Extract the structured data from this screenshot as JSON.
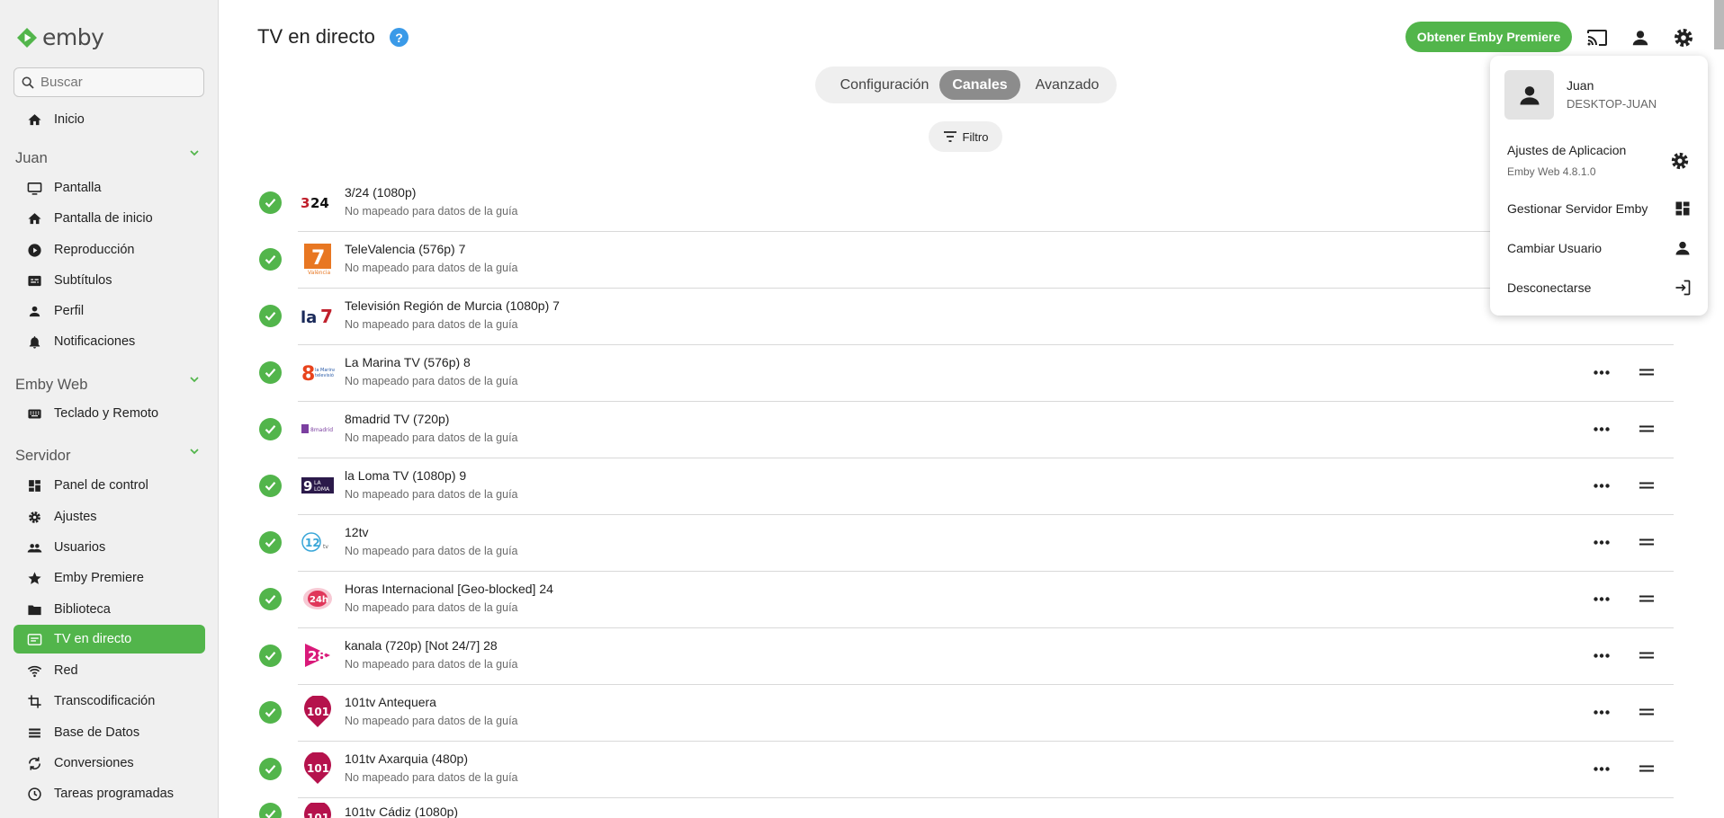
{
  "app": {
    "brand": "emby"
  },
  "colors": {
    "accent": "#52b54b",
    "help": "#3a9ae8"
  },
  "sidebar": {
    "search_placeholder": "Buscar",
    "home": "Inicio",
    "sections": [
      {
        "title": "Juan",
        "items": [
          "Pantalla",
          "Pantalla de inicio",
          "Reproducción",
          "Subtítulos",
          "Perfil",
          "Notificaciones"
        ]
      },
      {
        "title": "Emby Web",
        "items": [
          "Teclado y Remoto"
        ]
      },
      {
        "title": "Servidor",
        "items": [
          "Panel de control",
          "Ajustes",
          "Usuarios",
          "Emby Premiere",
          "Biblioteca",
          "TV en directo",
          "Red",
          "Transcodificación",
          "Base de Datos",
          "Conversiones",
          "Tareas programadas"
        ]
      }
    ],
    "active_item": "TV en directo"
  },
  "header": {
    "title": "TV en directo",
    "help_glyph": "?",
    "premiere_button": "Obtener Emby Premiere",
    "icons": [
      "cast-icon",
      "user-icon",
      "settings-icon"
    ]
  },
  "tabs": [
    {
      "label": "Configuración",
      "active": false
    },
    {
      "label": "Canales",
      "active": true
    },
    {
      "label": "Avanzado",
      "active": false
    }
  ],
  "filter_button": "Filtro",
  "channels": [
    {
      "name": "3/24 (1080p)",
      "status": "No mapeado para datos de la guía",
      "logo": "3/24"
    },
    {
      "name": "TeleValencia (576p) 7",
      "status": "No mapeado para datos de la guía",
      "logo": "7"
    },
    {
      "name": "Televisión Región de Murcia (1080p) 7",
      "status": "No mapeado para datos de la guía",
      "logo": "La 7"
    },
    {
      "name": "La Marina TV (576p) 8",
      "status": "No mapeado para datos de la guía",
      "logo": "8"
    },
    {
      "name": "8madrid TV (720p)",
      "status": "No mapeado para datos de la guía",
      "logo": "8madrid"
    },
    {
      "name": "la Loma TV (1080p) 9",
      "status": "No mapeado para datos de la guía",
      "logo": "9"
    },
    {
      "name": "12tv",
      "status": "No mapeado para datos de la guía",
      "logo": "12"
    },
    {
      "name": "Horas Internacional [Geo-blocked] 24",
      "status": "No mapeado para datos de la guía",
      "logo": "24h"
    },
    {
      "name": "kanala (720p) [Not 24/7] 28",
      "status": "No mapeado para datos de la guía",
      "logo": "28"
    },
    {
      "name": "101tv Antequera",
      "status": "No mapeado para datos de la guía",
      "logo": "101"
    },
    {
      "name": "101tv Axarquia (480p)",
      "status": "No mapeado para datos de la guía",
      "logo": "101"
    },
    {
      "name": "101tv Cádiz (1080p)",
      "status": "",
      "logo": "101"
    }
  ],
  "user_menu": {
    "user": "Juan",
    "host": "DESKTOP-JUAN",
    "items": [
      {
        "label": "Ajustes de Aplicacion",
        "sub": "Emby Web 4.8.1.0",
        "icon": "settings-icon"
      },
      {
        "label": "Gestionar Servidor Emby",
        "sub": "",
        "icon": "dashboard-icon"
      },
      {
        "label": "Cambiar Usuario",
        "sub": "",
        "icon": "person-icon"
      },
      {
        "label": "Desconectarse",
        "sub": "",
        "icon": "logout-icon"
      }
    ]
  }
}
